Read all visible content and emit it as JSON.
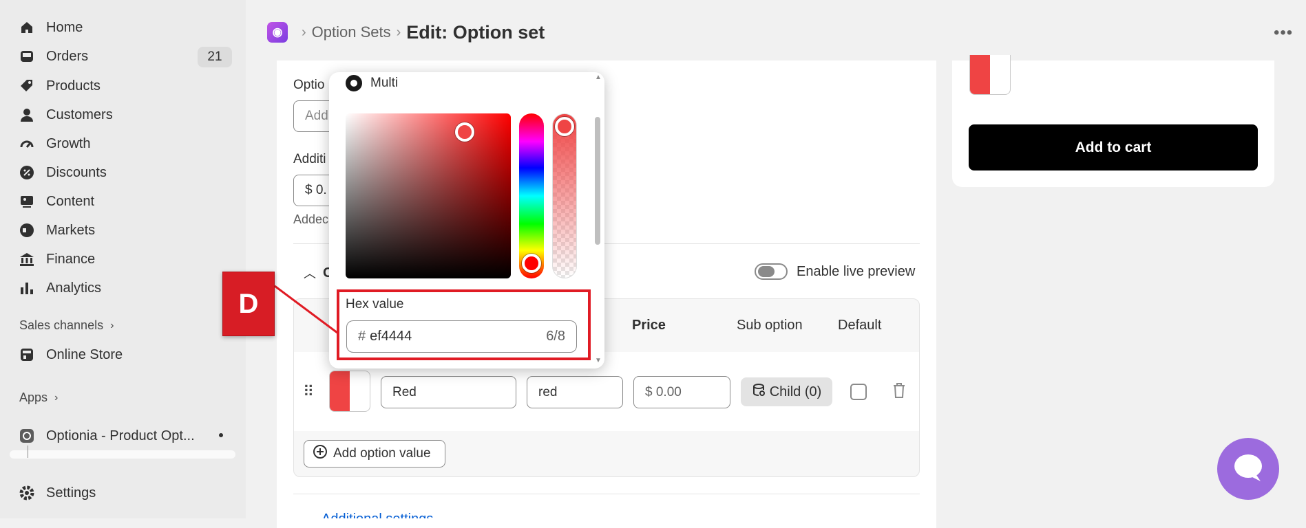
{
  "sidebar": {
    "items": [
      {
        "label": "Home",
        "icon": "home-icon"
      },
      {
        "label": "Orders",
        "icon": "inbox-icon",
        "badge": "21"
      },
      {
        "label": "Products",
        "icon": "tag-icon"
      },
      {
        "label": "Customers",
        "icon": "person-icon"
      },
      {
        "label": "Growth",
        "icon": "gauge-icon"
      },
      {
        "label": "Discounts",
        "icon": "discount-icon"
      },
      {
        "label": "Content",
        "icon": "image-icon"
      },
      {
        "label": "Markets",
        "icon": "globe-icon"
      },
      {
        "label": "Finance",
        "icon": "bank-icon"
      },
      {
        "label": "Analytics",
        "icon": "bar-chart-icon"
      }
    ],
    "sales_channels_label": "Sales channels",
    "online_store_label": "Online Store",
    "apps_label": "Apps",
    "app_name": "Optionia - Product Opt...",
    "settings_label": "Settings"
  },
  "header": {
    "crumb_parent": "Option Sets",
    "title": "Edit: Option set"
  },
  "form": {
    "option_label_partial": "Optio",
    "add_placeholder_partial": "Add",
    "additional_label_partial": "Additi",
    "price_partial": "$ 0.",
    "added_help_partial": "Addec",
    "collapsible_partial": "O",
    "live_preview_label": "Enable live preview",
    "additional_settings_partial": "Additional settings"
  },
  "table": {
    "headers": {
      "price": "Price",
      "sub_option": "Sub option",
      "default": "Default"
    },
    "row": {
      "label_value": "Red",
      "value_value": "red",
      "price_value": "$ 0.00",
      "child_label": "Child (0)",
      "swatch_color": "#ef4444"
    },
    "add_value_label": "Add option value"
  },
  "picker": {
    "mode_label": "Multi",
    "hex_label": "Hex value",
    "hex_prefix": "#",
    "hex_value": "ef4444",
    "hex_count": "6/8"
  },
  "preview": {
    "add_to_cart_label": "Add to cart"
  },
  "annotation": {
    "letter": "D",
    "color": "#d71d25"
  }
}
